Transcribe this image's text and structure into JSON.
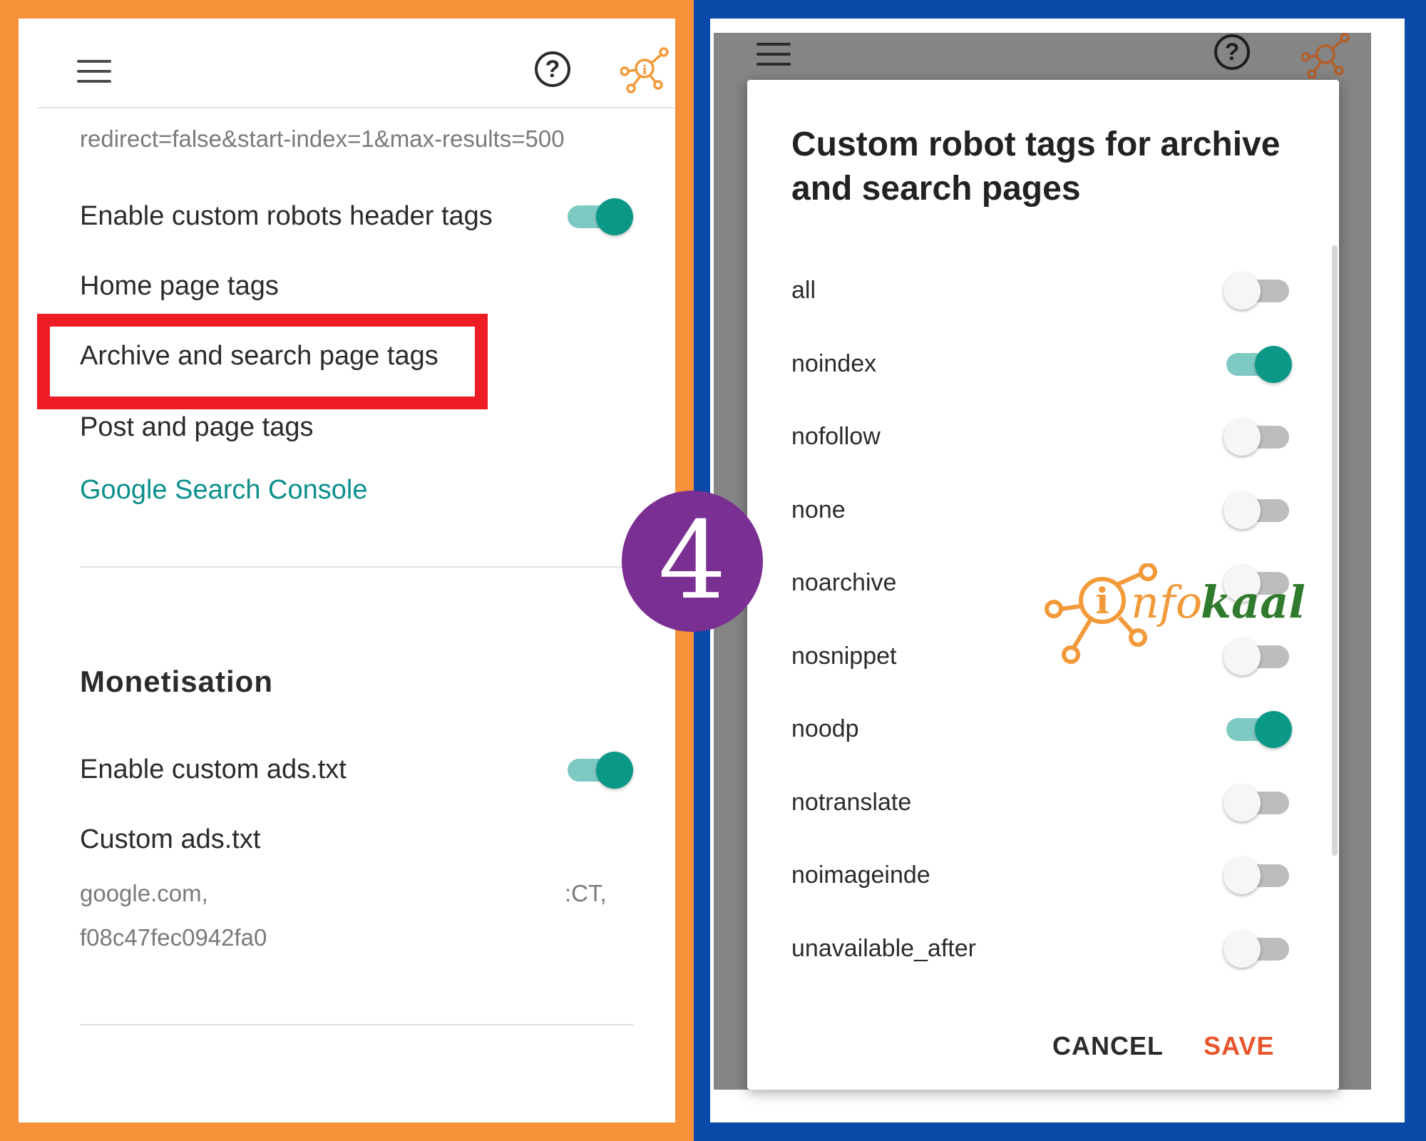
{
  "colors": {
    "frame_left": "#f7923a",
    "frame_right": "#0a4aa8",
    "accent_teal": "#0c9886",
    "link": "#0c8f8b",
    "highlight": "#ee1c25",
    "badge": "#7a2f92",
    "save": "#e8542b"
  },
  "left": {
    "query_text": "redirect=false&start-index=1&max-results=500",
    "enable_robots": {
      "label": "Enable custom robots header tags",
      "on": true
    },
    "home_tags": "Home page tags",
    "archive_tags": "Archive and search page tags",
    "post_tags": "Post and page tags",
    "gsc_link": "Google Search Console",
    "monetisation_heading": "Monetisation",
    "enable_ads": {
      "label": "Enable custom ads.txt",
      "on": true
    },
    "custom_ads": "Custom ads.txt",
    "ads_line1": "google.com,",
    "ads_line1_end": ":CT,",
    "ads_line2": "f08c47fec0942fa0"
  },
  "step": {
    "number": "4"
  },
  "dialog": {
    "title_line1": "Custom robot tags for archive",
    "title_line2": "and search pages",
    "options": [
      {
        "label": "all",
        "on": false
      },
      {
        "label": "noindex",
        "on": true
      },
      {
        "label": "nofollow",
        "on": false
      },
      {
        "label": "none",
        "on": false
      },
      {
        "label": "noarchive",
        "on": false
      },
      {
        "label": "nosnippet",
        "on": false
      },
      {
        "label": "noodp",
        "on": true
      },
      {
        "label": "notranslate",
        "on": false
      },
      {
        "label": "noimageinde",
        "on": false
      },
      {
        "label": "unavailable_after",
        "on": false
      }
    ],
    "cancel": "CANCEL",
    "save": "SAVE"
  },
  "watermark": {
    "i": "i",
    "nfo": "nfo",
    "kaal": "kaal"
  },
  "icons": {
    "menu": "hamburger-menu-icon",
    "help": "help-circle-icon",
    "brand": "network-logo-icon"
  }
}
